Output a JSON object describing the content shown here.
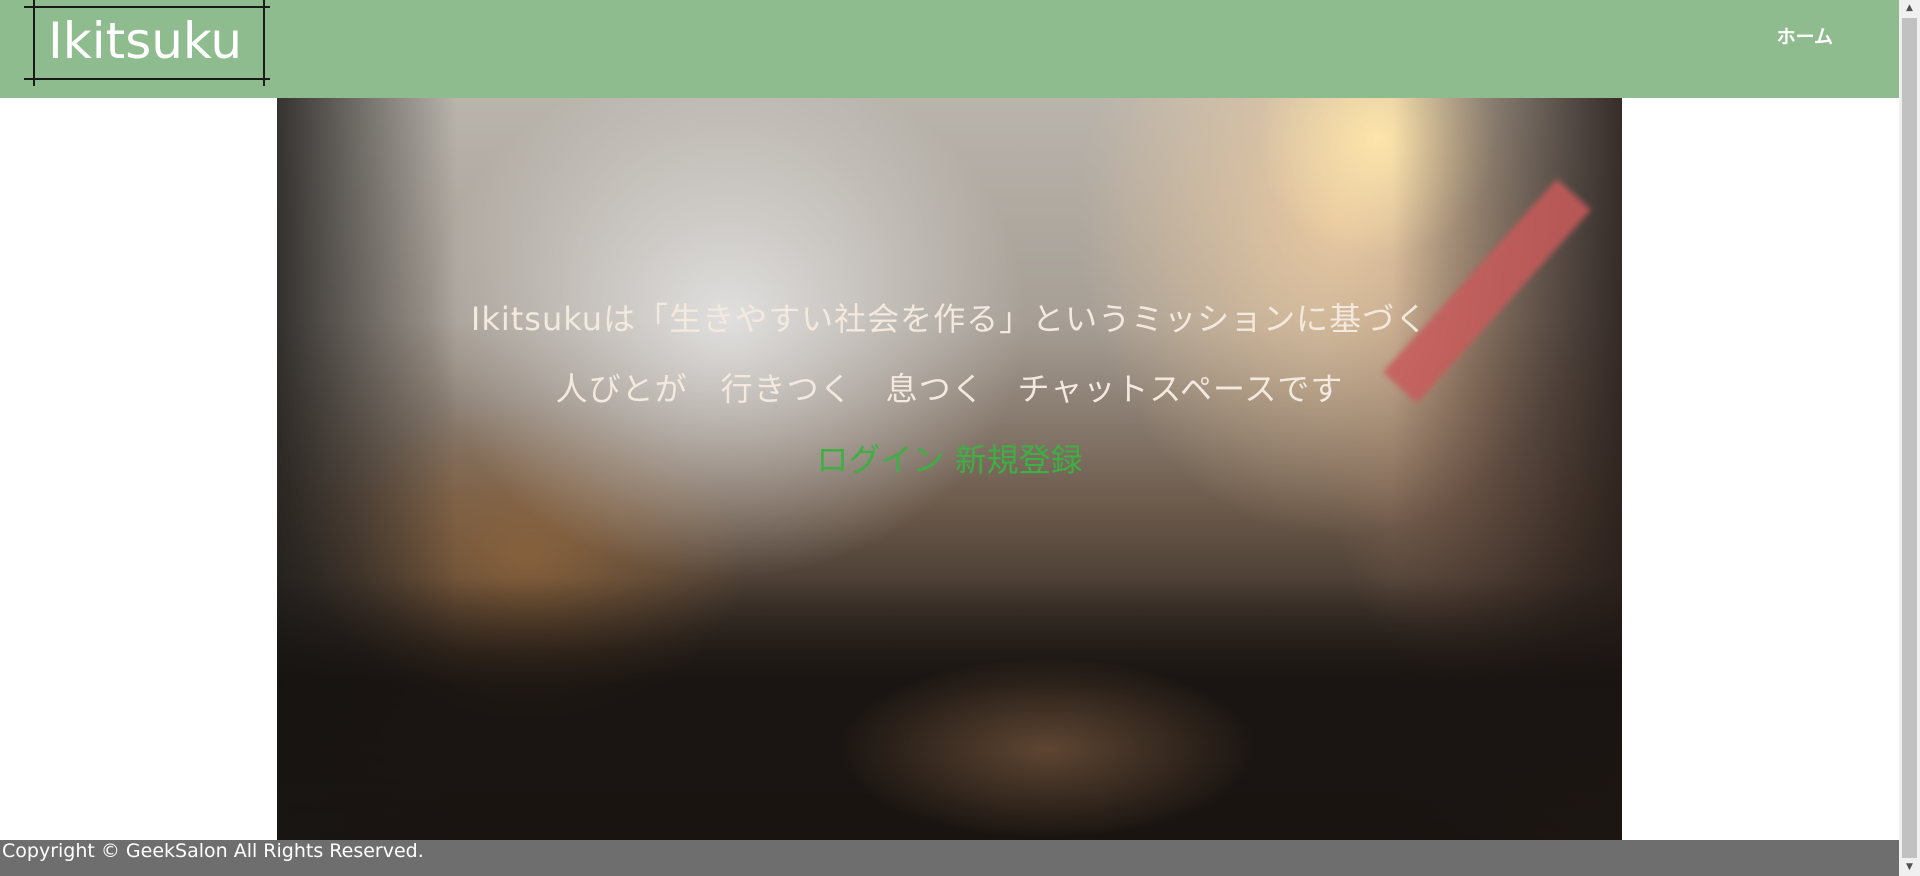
{
  "header": {
    "logo_text": "Ikitsuku",
    "nav_home": "ホーム",
    "background_color": "#8fbc8f"
  },
  "hero": {
    "line1": "Ikitsukuは「生きやすい社会を作る」というミッションに基づく",
    "line2": "人びとが　行きつく　息つく　チャットスペースです",
    "login_link": "ログイン",
    "signup_link": "新規登録",
    "link_color": "#3cb043"
  },
  "footer": {
    "copyright": "Copyright © GeekSalon All Rights Reserved.",
    "background_color": "#6e6e6e"
  },
  "scrollbar": {
    "up_icon": "triangle-up-icon",
    "down_icon": "triangle-down-icon"
  }
}
